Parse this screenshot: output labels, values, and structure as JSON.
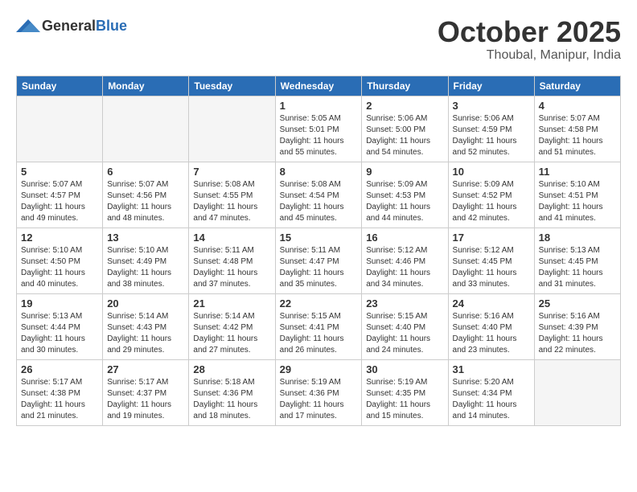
{
  "header": {
    "logo_general": "General",
    "logo_blue": "Blue",
    "month_title": "October 2025",
    "location": "Thoubal, Manipur, India"
  },
  "weekdays": [
    "Sunday",
    "Monday",
    "Tuesday",
    "Wednesday",
    "Thursday",
    "Friday",
    "Saturday"
  ],
  "weeks": [
    [
      {
        "day": "",
        "sunrise": "",
        "sunset": "",
        "daylight": ""
      },
      {
        "day": "",
        "sunrise": "",
        "sunset": "",
        "daylight": ""
      },
      {
        "day": "",
        "sunrise": "",
        "sunset": "",
        "daylight": ""
      },
      {
        "day": "1",
        "sunrise": "Sunrise: 5:05 AM",
        "sunset": "Sunset: 5:01 PM",
        "daylight": "Daylight: 11 hours and 55 minutes."
      },
      {
        "day": "2",
        "sunrise": "Sunrise: 5:06 AM",
        "sunset": "Sunset: 5:00 PM",
        "daylight": "Daylight: 11 hours and 54 minutes."
      },
      {
        "day": "3",
        "sunrise": "Sunrise: 5:06 AM",
        "sunset": "Sunset: 4:59 PM",
        "daylight": "Daylight: 11 hours and 52 minutes."
      },
      {
        "day": "4",
        "sunrise": "Sunrise: 5:07 AM",
        "sunset": "Sunset: 4:58 PM",
        "daylight": "Daylight: 11 hours and 51 minutes."
      }
    ],
    [
      {
        "day": "5",
        "sunrise": "Sunrise: 5:07 AM",
        "sunset": "Sunset: 4:57 PM",
        "daylight": "Daylight: 11 hours and 49 minutes."
      },
      {
        "day": "6",
        "sunrise": "Sunrise: 5:07 AM",
        "sunset": "Sunset: 4:56 PM",
        "daylight": "Daylight: 11 hours and 48 minutes."
      },
      {
        "day": "7",
        "sunrise": "Sunrise: 5:08 AM",
        "sunset": "Sunset: 4:55 PM",
        "daylight": "Daylight: 11 hours and 47 minutes."
      },
      {
        "day": "8",
        "sunrise": "Sunrise: 5:08 AM",
        "sunset": "Sunset: 4:54 PM",
        "daylight": "Daylight: 11 hours and 45 minutes."
      },
      {
        "day": "9",
        "sunrise": "Sunrise: 5:09 AM",
        "sunset": "Sunset: 4:53 PM",
        "daylight": "Daylight: 11 hours and 44 minutes."
      },
      {
        "day": "10",
        "sunrise": "Sunrise: 5:09 AM",
        "sunset": "Sunset: 4:52 PM",
        "daylight": "Daylight: 11 hours and 42 minutes."
      },
      {
        "day": "11",
        "sunrise": "Sunrise: 5:10 AM",
        "sunset": "Sunset: 4:51 PM",
        "daylight": "Daylight: 11 hours and 41 minutes."
      }
    ],
    [
      {
        "day": "12",
        "sunrise": "Sunrise: 5:10 AM",
        "sunset": "Sunset: 4:50 PM",
        "daylight": "Daylight: 11 hours and 40 minutes."
      },
      {
        "day": "13",
        "sunrise": "Sunrise: 5:10 AM",
        "sunset": "Sunset: 4:49 PM",
        "daylight": "Daylight: 11 hours and 38 minutes."
      },
      {
        "day": "14",
        "sunrise": "Sunrise: 5:11 AM",
        "sunset": "Sunset: 4:48 PM",
        "daylight": "Daylight: 11 hours and 37 minutes."
      },
      {
        "day": "15",
        "sunrise": "Sunrise: 5:11 AM",
        "sunset": "Sunset: 4:47 PM",
        "daylight": "Daylight: 11 hours and 35 minutes."
      },
      {
        "day": "16",
        "sunrise": "Sunrise: 5:12 AM",
        "sunset": "Sunset: 4:46 PM",
        "daylight": "Daylight: 11 hours and 34 minutes."
      },
      {
        "day": "17",
        "sunrise": "Sunrise: 5:12 AM",
        "sunset": "Sunset: 4:45 PM",
        "daylight": "Daylight: 11 hours and 33 minutes."
      },
      {
        "day": "18",
        "sunrise": "Sunrise: 5:13 AM",
        "sunset": "Sunset: 4:45 PM",
        "daylight": "Daylight: 11 hours and 31 minutes."
      }
    ],
    [
      {
        "day": "19",
        "sunrise": "Sunrise: 5:13 AM",
        "sunset": "Sunset: 4:44 PM",
        "daylight": "Daylight: 11 hours and 30 minutes."
      },
      {
        "day": "20",
        "sunrise": "Sunrise: 5:14 AM",
        "sunset": "Sunset: 4:43 PM",
        "daylight": "Daylight: 11 hours and 29 minutes."
      },
      {
        "day": "21",
        "sunrise": "Sunrise: 5:14 AM",
        "sunset": "Sunset: 4:42 PM",
        "daylight": "Daylight: 11 hours and 27 minutes."
      },
      {
        "day": "22",
        "sunrise": "Sunrise: 5:15 AM",
        "sunset": "Sunset: 4:41 PM",
        "daylight": "Daylight: 11 hours and 26 minutes."
      },
      {
        "day": "23",
        "sunrise": "Sunrise: 5:15 AM",
        "sunset": "Sunset: 4:40 PM",
        "daylight": "Daylight: 11 hours and 24 minutes."
      },
      {
        "day": "24",
        "sunrise": "Sunrise: 5:16 AM",
        "sunset": "Sunset: 4:40 PM",
        "daylight": "Daylight: 11 hours and 23 minutes."
      },
      {
        "day": "25",
        "sunrise": "Sunrise: 5:16 AM",
        "sunset": "Sunset: 4:39 PM",
        "daylight": "Daylight: 11 hours and 22 minutes."
      }
    ],
    [
      {
        "day": "26",
        "sunrise": "Sunrise: 5:17 AM",
        "sunset": "Sunset: 4:38 PM",
        "daylight": "Daylight: 11 hours and 21 minutes."
      },
      {
        "day": "27",
        "sunrise": "Sunrise: 5:17 AM",
        "sunset": "Sunset: 4:37 PM",
        "daylight": "Daylight: 11 hours and 19 minutes."
      },
      {
        "day": "28",
        "sunrise": "Sunrise: 5:18 AM",
        "sunset": "Sunset: 4:36 PM",
        "daylight": "Daylight: 11 hours and 18 minutes."
      },
      {
        "day": "29",
        "sunrise": "Sunrise: 5:19 AM",
        "sunset": "Sunset: 4:36 PM",
        "daylight": "Daylight: 11 hours and 17 minutes."
      },
      {
        "day": "30",
        "sunrise": "Sunrise: 5:19 AM",
        "sunset": "Sunset: 4:35 PM",
        "daylight": "Daylight: 11 hours and 15 minutes."
      },
      {
        "day": "31",
        "sunrise": "Sunrise: 5:20 AM",
        "sunset": "Sunset: 4:34 PM",
        "daylight": "Daylight: 11 hours and 14 minutes."
      },
      {
        "day": "",
        "sunrise": "",
        "sunset": "",
        "daylight": ""
      }
    ]
  ]
}
